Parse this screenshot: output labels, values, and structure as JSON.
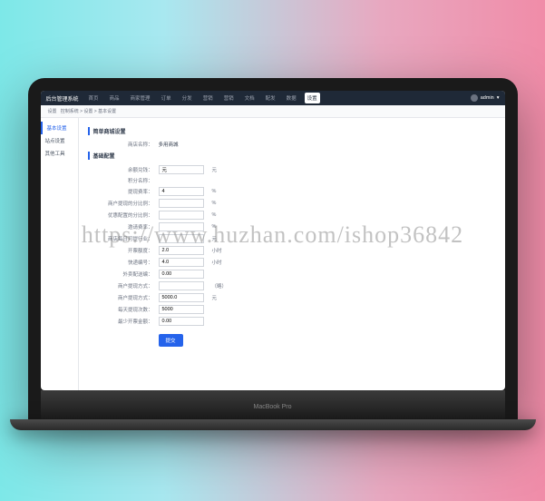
{
  "watermark": "https://www.huzhan.com/ishop36842",
  "header": {
    "brand": "后台管理系统",
    "nav": [
      "首页",
      "商品",
      "商家管理",
      "订单",
      "分发",
      "营销",
      "营销",
      "文档",
      "配发",
      "数据",
      "设置"
    ],
    "active_index": 10,
    "user": "admin",
    "user_icon": "▾"
  },
  "breadcrumb": {
    "prefix": "设置",
    "path": "控制系统 > 设置 > 基本设置"
  },
  "sidebar": {
    "items": [
      "基本设置",
      "站点设置",
      "其他工具"
    ],
    "active_index": 0
  },
  "section1": {
    "title": "简单商城设置",
    "label": "商店名称：",
    "value": "多用商城"
  },
  "section2": {
    "title": "基础配置",
    "rows": [
      {
        "label": "余额兑钱：",
        "value": "元",
        "input": "",
        "unit": "元"
      },
      {
        "label": "积分名称：",
        "value": ""
      },
      {
        "label": "提现费率：",
        "value": "4",
        "unit": "%"
      },
      {
        "label": "商户提现的分比例：",
        "value": "",
        "unit": "%"
      },
      {
        "label": "优惠配置的分比例：",
        "value": "",
        "unit": "%"
      },
      {
        "label": "邀请费率：",
        "value": "",
        "unit": "%"
      },
      {
        "label": "商店每日可提行业：",
        "value": "",
        "unit": "元"
      },
      {
        "label": "开票额度：",
        "value": "2.0",
        "unit": "小时"
      },
      {
        "label": "快递编号：",
        "value": "4.0",
        "unit": "小时"
      },
      {
        "label": "外卖配送编：",
        "value": "0.00",
        "unit": ""
      },
      {
        "label": "商户提现方式：",
        "value": "",
        "unit": "（略）"
      },
      {
        "label": "商户提现方式：",
        "value": "5000.0",
        "unit": "元"
      },
      {
        "label": "每天提现次数：",
        "value": "5000",
        "unit": ""
      },
      {
        "label": "最少开票金额：",
        "value": "0.00",
        "unit": ""
      }
    ]
  },
  "button": "提交",
  "laptop_brand": "MacBook Pro"
}
